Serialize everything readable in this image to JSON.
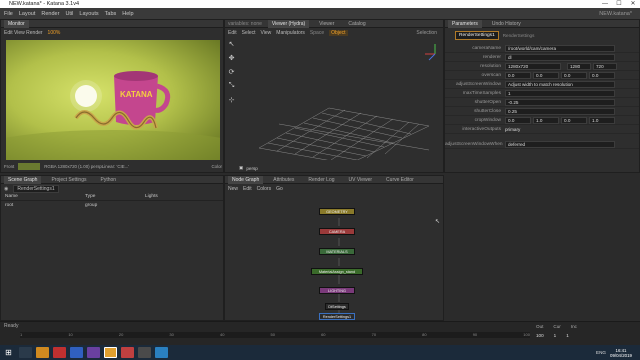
{
  "window": {
    "title": "NEW.katana* - Katana 3.1v4",
    "min": "—",
    "max": "☐",
    "close": "✕"
  },
  "menu": [
    "File",
    "Layout",
    "Render",
    "Util",
    "Layouts",
    "Tabs",
    "Help"
  ],
  "menu_right": {
    "sample": "No sample tuned",
    "version": "NEW.katana*"
  },
  "monitor": {
    "title": "Monitor",
    "toolbar": "Edit View Render",
    "zoom": "100%",
    "status_left": "Front",
    "status_mid": "RGBA  1280x720 (1.00) perspLinear: 'CIE...'",
    "status_right": "Color",
    "brand": "KATANA"
  },
  "viewer": {
    "tabs": [
      "Viewer (Hydra)",
      "Viewer",
      "Catalog"
    ],
    "header_left": "variables: none",
    "menus": [
      "Edit",
      "Select",
      "View",
      "Manipulators"
    ],
    "space": "Space",
    "object": "Object",
    "selection": "Selection",
    "camera": "persp"
  },
  "scenegraph": {
    "tabs": [
      "Scene Graph",
      "Project Settings",
      "Python"
    ],
    "target": "RenderSettings1",
    "columns": [
      "Name",
      "Type",
      "Lights"
    ],
    "rows": [
      {
        "name": "root",
        "type": "group"
      }
    ]
  },
  "nodegraph": {
    "tabs": [
      "Node Graph",
      "Attributes",
      "Render Log",
      "UV Viewer",
      "Curve Editor"
    ],
    "menus": [
      "New",
      "Edit",
      "Colors",
      "Go"
    ],
    "nodes": [
      {
        "label": "GEOMETRY",
        "color": "#8a7a2a"
      },
      {
        "label": "CAMERA",
        "color": "#9a3a3a"
      },
      {
        "label": "MATERIALS",
        "color": "#3a6a3a"
      },
      {
        "label": "MaterialAssign_stand",
        "color": "#3a6a2a"
      },
      {
        "label": "LIGHTING",
        "color": "#7a3a7a"
      },
      {
        "label": "DtSettings",
        "color": "#2b2b2b"
      },
      {
        "label": "RenderSettings1",
        "color": "#2b2b2b"
      }
    ]
  },
  "params": {
    "tabs": [
      "Parameters",
      "Undo History"
    ],
    "node": "RenderSettings1",
    "type": "RenderSettings",
    "rows": [
      {
        "label": "cameraName",
        "value": "/root/world/cam/camera"
      },
      {
        "label": "renderer",
        "value": "dl"
      },
      {
        "label": "resolution",
        "value": "1280x720",
        "v2": "1280",
        "v3": "720"
      },
      {
        "label": "overscan",
        "value": "0.0",
        "v2": "0.0",
        "v3": "0.0",
        "v4": "0.0"
      },
      {
        "label": "adjustScreenWindow",
        "value": "Adjust width to match resolution"
      },
      {
        "label": "maxTimeSamples",
        "value": "1"
      },
      {
        "label": "shutterOpen",
        "value": "-0.25"
      },
      {
        "label": "shutterClose",
        "value": "0.25"
      },
      {
        "label": "cropWindow",
        "value": "0.0",
        "v2": "1.0",
        "v3": "0.0",
        "v4": "1.0"
      },
      {
        "label": "interactiveOutputs",
        "value": "primary"
      },
      {
        "label": "adjustScreenWindowWhen",
        "value": "deferred"
      }
    ]
  },
  "timeline": {
    "status": "Ready",
    "ticks": [
      "1",
      "10",
      "20",
      "30",
      "40",
      "50",
      "60",
      "70",
      "80",
      "90",
      "100"
    ],
    "out_label": "Out",
    "cur_label": "Cur",
    "inc_label": "Inc",
    "out": "100",
    "cur": "1",
    "inc": "1"
  },
  "taskbar": {
    "lang": "ENG",
    "time": "16:41",
    "date": "09/04/2019"
  }
}
